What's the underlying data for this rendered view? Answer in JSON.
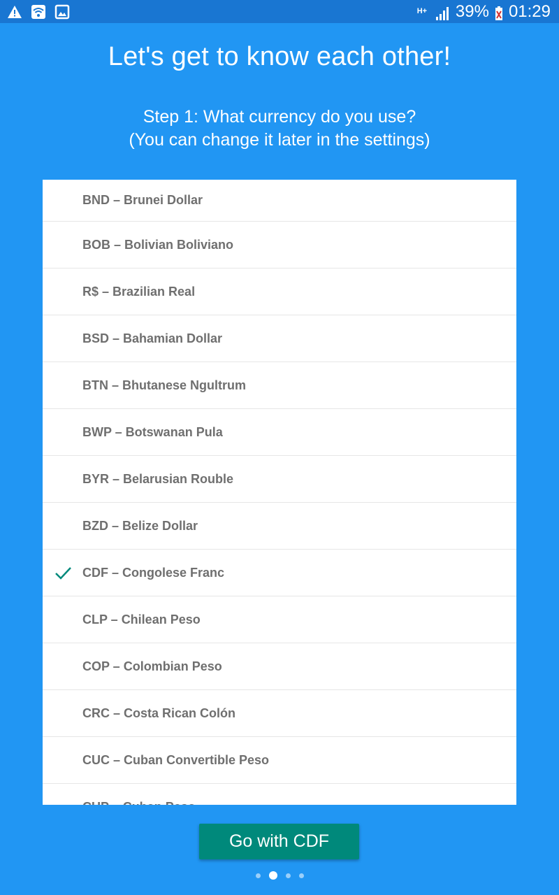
{
  "status_bar": {
    "network_type": "H+",
    "battery_percent": "39%",
    "time": "01:29",
    "icons": [
      "warning-icon",
      "wifi-icon",
      "gallery-icon",
      "signal-icon",
      "battery-icon"
    ]
  },
  "header": {
    "title": "Let's get to know each other!",
    "subtitle_line1": "Step 1: What currency do you use?",
    "subtitle_line2": "(You can change it later in the settings)"
  },
  "currency_list": {
    "selected": "CDF",
    "items": [
      {
        "label": "BND – Brunei Dollar",
        "selected": false
      },
      {
        "label": "BOB – Bolivian Boliviano",
        "selected": false
      },
      {
        "label": "R$ – Brazilian Real",
        "selected": false
      },
      {
        "label": "BSD – Bahamian Dollar",
        "selected": false
      },
      {
        "label": "BTN – Bhutanese Ngultrum",
        "selected": false
      },
      {
        "label": "BWP – Botswanan Pula",
        "selected": false
      },
      {
        "label": "BYR – Belarusian Rouble",
        "selected": false
      },
      {
        "label": "BZD – Belize Dollar",
        "selected": false
      },
      {
        "label": "CDF – Congolese Franc",
        "selected": true
      },
      {
        "label": "CLP – Chilean Peso",
        "selected": false
      },
      {
        "label": "COP – Colombian Peso",
        "selected": false
      },
      {
        "label": "CRC – Costa Rican Colón",
        "selected": false
      },
      {
        "label": "CUC – Cuban Convertible Peso",
        "selected": false
      },
      {
        "label": "CUP – Cuban Peso",
        "selected": false
      }
    ]
  },
  "footer": {
    "button_label": "Go with CDF",
    "pager": {
      "total": 4,
      "current": 2
    }
  },
  "colors": {
    "background": "#2196f3",
    "status_bar": "#1976d2",
    "accent": "#00897b",
    "item_text": "#6f6f6f"
  }
}
